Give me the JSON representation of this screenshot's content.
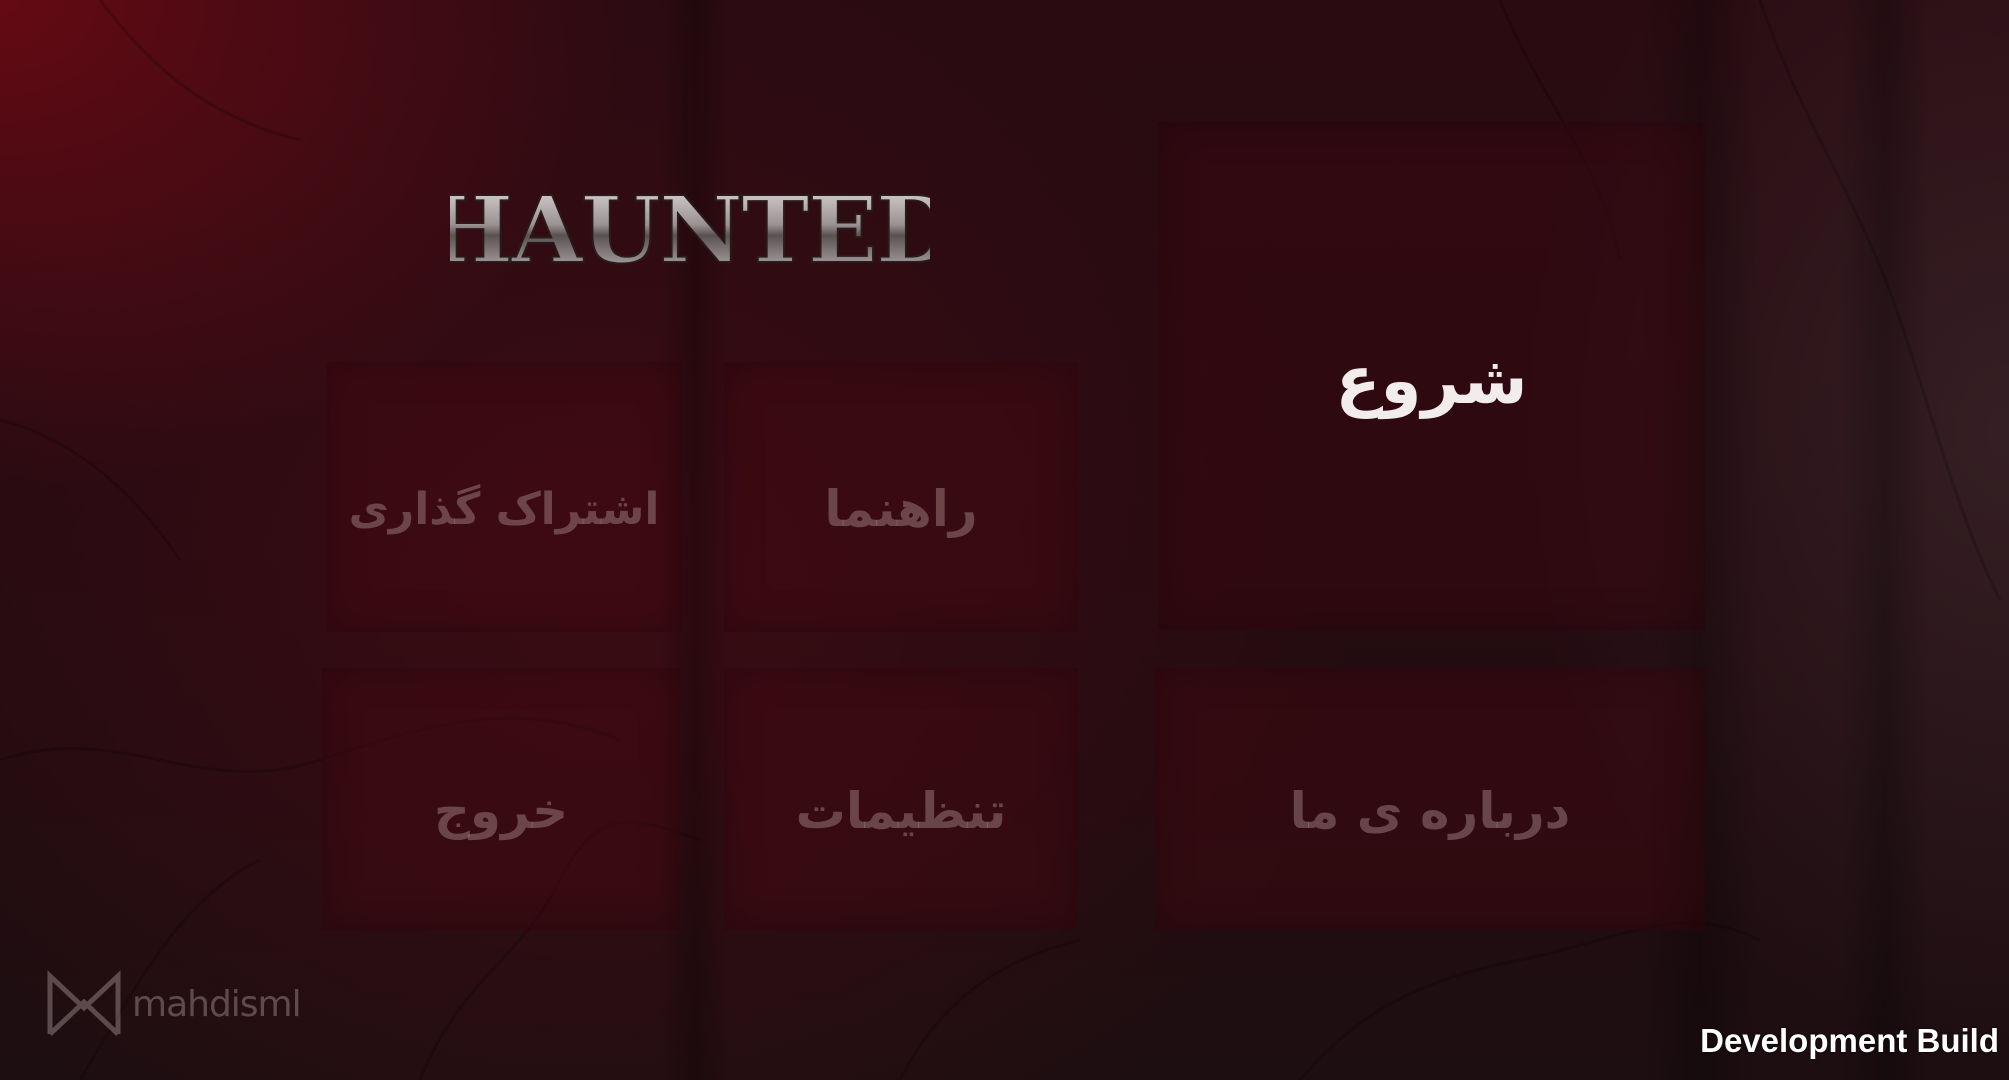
{
  "game": {
    "logo_text": "HAUNTED"
  },
  "menu": {
    "start": "شروع",
    "share": "اشتراک گذاری",
    "guide": "راهنما",
    "exit": "خروج",
    "settings": "تنظیمات",
    "about": "درباره ی ما"
  },
  "watermark": {
    "text": "mahdisml"
  },
  "build": {
    "label": "Development Build"
  },
  "colors": {
    "background": "#250b11",
    "tile": "#460a10",
    "active_text": "#f2ecec",
    "inactive_text": "#967676"
  }
}
